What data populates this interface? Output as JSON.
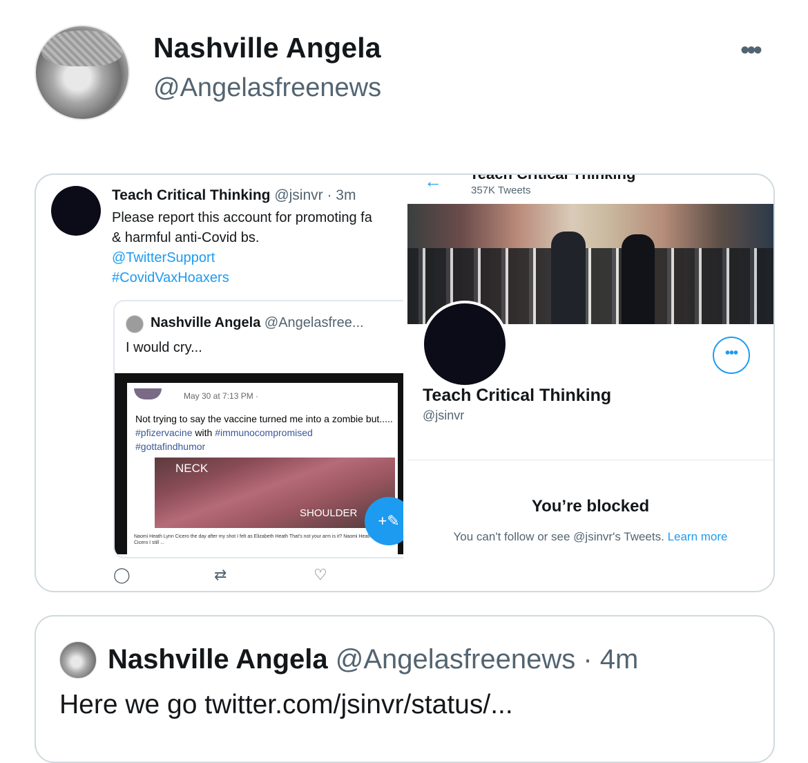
{
  "author": {
    "name": "Nashville Angela",
    "handle": "@Angelasfreenews"
  },
  "more_glyph": "•••",
  "screenshot": {
    "left": {
      "name": "Teach Critical Thinking",
      "handle_time": "@jsinvr · 3m",
      "line1": "Please report this account for promoting fa",
      "line2": "& harmful anti-Covid bs.",
      "mention": "@TwitterSupport",
      "hashtag": "#CovidVaxHoaxers",
      "quoted": {
        "name": "Nashville Angela",
        "handle": "@Angelasfree...",
        "text": "I would cry...",
        "fb_meta": "May 30 at 7:13 PM · ",
        "fb_text_a": "Not trying to say the vaccine turned me into a zombie but..... ",
        "fb_tag1": "#pfizervacine",
        "fb_with": " with ",
        "fb_tag2": "#immunocompromised",
        "fb_tag3": "#gottafindhumor",
        "photo_neck": "NECK",
        "photo_shoulder": "SHOULDER",
        "comments": "Naomi Heath  Lynn Cicero the day after my shot I felt as    Elizabeth Heath  That's not your arm is it?    Naomi Heath  Lynn Cicero I still ..."
      },
      "icons": {
        "reply": "◯",
        "retweet": "⇄",
        "like": "♡"
      }
    },
    "right": {
      "title": "Teach Critical Thinking",
      "tweet_count": "357K Tweets",
      "name": "Teach Critical Thinking",
      "handle": "@jsinvr",
      "blocked_title": "You’re blocked",
      "blocked_sub": "You can't follow or see @jsinvr's Tweets. ",
      "learn_more": "Learn more"
    }
  },
  "quoted_tweet": {
    "name": "Nashville Angela",
    "handle_time": "@Angelasfreenews · 4m",
    "text": "Here we go twitter.com/jsinvr/status/..."
  }
}
